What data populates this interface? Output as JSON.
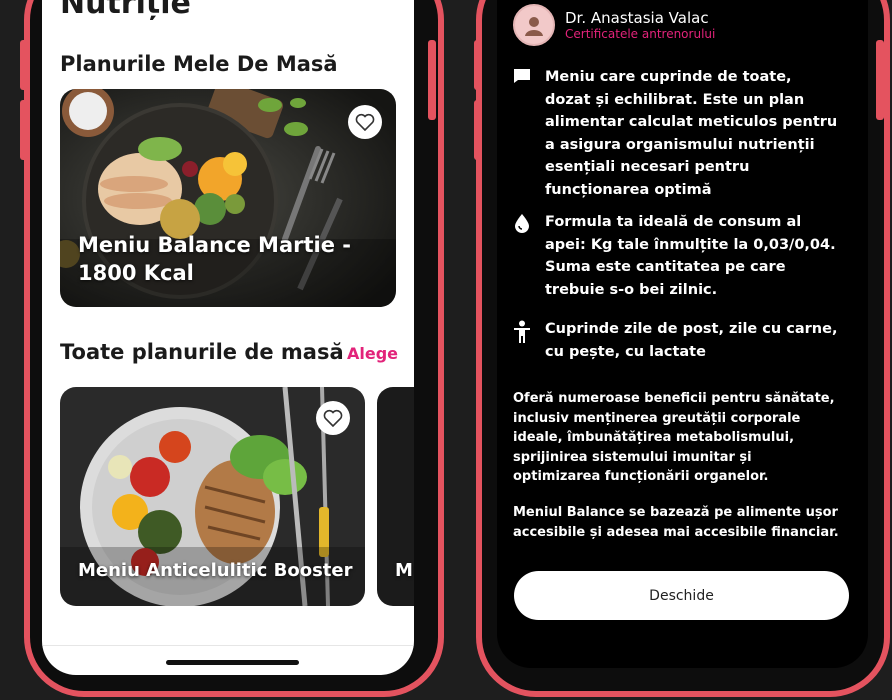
{
  "left_screen": {
    "page_title": "Nutriție",
    "my_plans_heading": "Planurile Mele De Masă",
    "featured_card": {
      "title": "Meniu Balance Martie - 1800 Kcal"
    },
    "all_plans_heading": "Toate planurile de masă",
    "choose_link": "Alege",
    "plan_cards": [
      {
        "title": "Meniu Anticelulitic Booster"
      },
      {
        "title": "M"
      }
    ]
  },
  "right_screen": {
    "coach": {
      "name": "Dr. Anastasia Valac",
      "subtitle": "Certificatele antrenorului"
    },
    "features": [
      {
        "icon": "chat-bubble-icon",
        "text": "Meniu care cuprinde de toate, dozat și echilibrat. Este un plan alimentar calculat meticulos pentru a asigura organismului nutrienții esențiali necesari pentru funcționarea optimă"
      },
      {
        "icon": "water-drop-icon",
        "text": "Formula ta ideală de consum al apei: Kg tale înmulțite la 0,03/0,04. Suma este cantitatea pe care trebuie s-o bei zilnic."
      },
      {
        "icon": "person-icon",
        "text": "Cuprinde zile de post, zile cu carne, cu pește, cu lactate"
      }
    ],
    "paragraphs": [
      "Oferă numeroase beneficii pentru sănătate, inclusiv menținerea greutății corporale ideale, îmbunătățirea metabolismului, sprijinirea sistemului imunitar și optimizarea funcționării organelor.",
      "Meniul Balance se bazează pe alimente ușor accesibile și adesea mai accesibile financiar."
    ],
    "open_button": "Deschide"
  },
  "colors": {
    "frame": "#e4535f",
    "accent": "#e2237a",
    "dark_bg": "#000000"
  }
}
